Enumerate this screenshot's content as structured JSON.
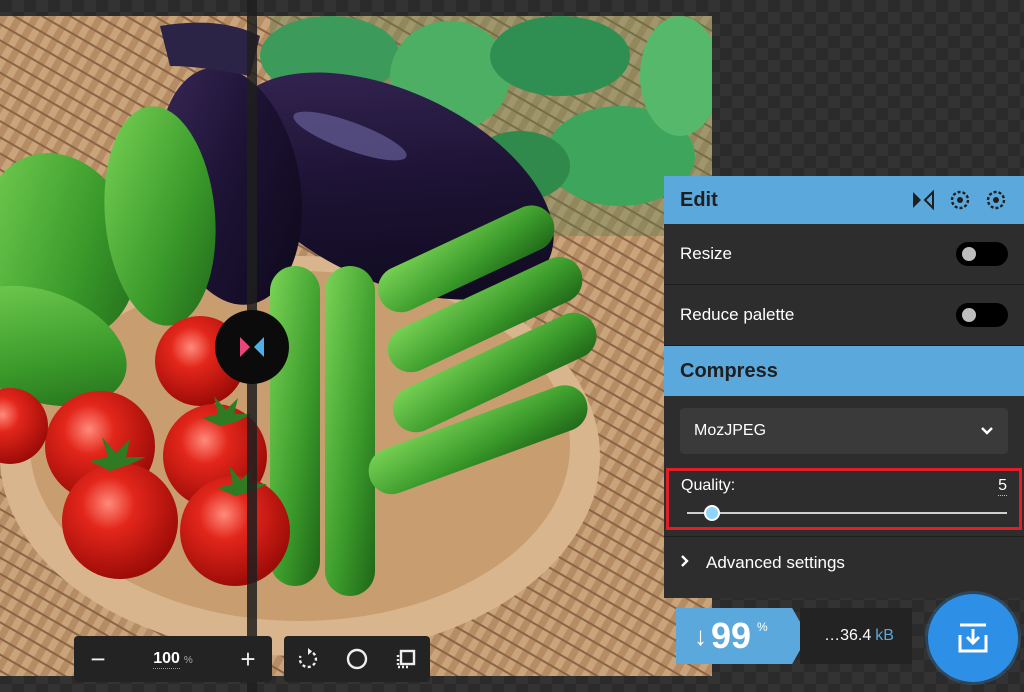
{
  "edit_panel": {
    "title": "Edit",
    "resize_label": "Resize",
    "reduce_palette_label": "Reduce palette"
  },
  "compress": {
    "title": "Compress",
    "codec": "MozJPEG",
    "quality_label": "Quality:",
    "quality_value": "5",
    "advanced_label": "Advanced settings"
  },
  "zoom": {
    "value": "100",
    "unit": "%",
    "minus": "−",
    "plus": "+"
  },
  "result": {
    "arrow": "↓",
    "percent": "99",
    "percent_sign": "%",
    "size": "…36.4",
    "size_unit": "kB"
  },
  "colors": {
    "accent": "#5ba8dc",
    "highlight": "#e21d26",
    "download": "#2e8fe6"
  }
}
